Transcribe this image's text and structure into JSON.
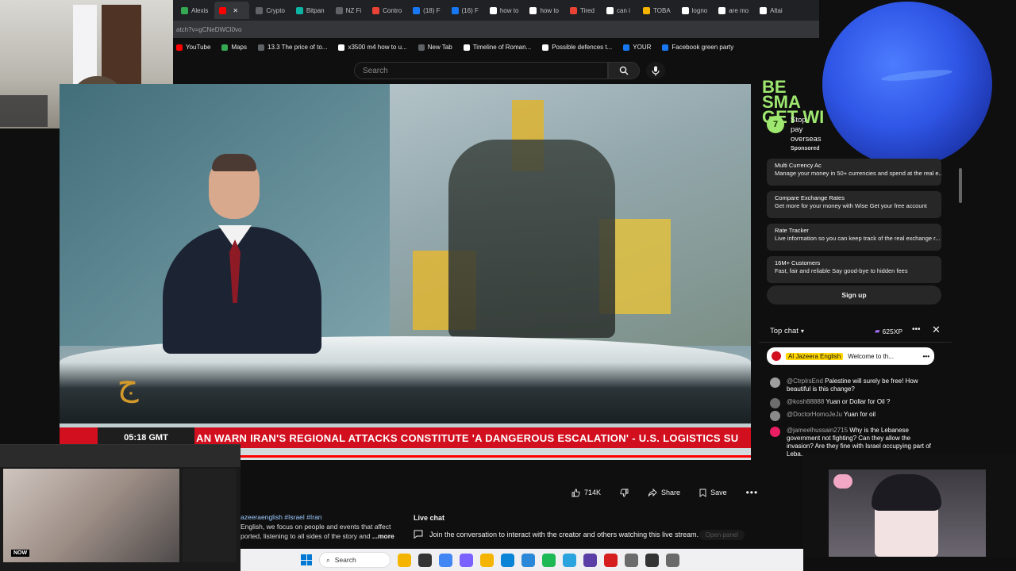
{
  "browser": {
    "tabs": [
      {
        "label": "Alexis",
        "color": "#34a853"
      },
      {
        "label": "",
        "color": "#ff0000",
        "active": true
      },
      {
        "label": "Crypto",
        "color": "#5f6368"
      },
      {
        "label": "Bitpan",
        "color": "#0db5a4"
      },
      {
        "label": "NZ Fi",
        "color": "#5f6368"
      },
      {
        "label": "Contro",
        "color": "#ea4335"
      },
      {
        "label": "(18) F",
        "color": "#1877f2"
      },
      {
        "label": "(16) F",
        "color": "#1877f2"
      },
      {
        "label": "how to",
        "color": "#ffffff"
      },
      {
        "label": "how to",
        "color": "#ffffff"
      },
      {
        "label": "Tired",
        "color": "#ea4335"
      },
      {
        "label": "can i",
        "color": "#ffffff"
      },
      {
        "label": "TOBA",
        "color": "#f4b400"
      },
      {
        "label": "logno",
        "color": "#ffffff"
      },
      {
        "label": "are mo",
        "color": "#ffffff"
      },
      {
        "label": "Altai",
        "color": "#ffffff"
      }
    ],
    "address": "atch?v=gCNeDWCl0vo",
    "bookmarks": [
      {
        "label": "YouTube",
        "color": "#ff0000"
      },
      {
        "label": "Maps",
        "color": "#34a853"
      },
      {
        "label": "13.3 The price of to...",
        "color": "#5f6368"
      },
      {
        "label": "x3500 m4 how to u...",
        "color": "#ffffff"
      },
      {
        "label": "New Tab",
        "color": "#5f6368"
      },
      {
        "label": "Timeline of Roman...",
        "color": "#ffffff"
      },
      {
        "label": "Possible defences t...",
        "color": "#ffffff"
      },
      {
        "label": "YOUR",
        "color": "#1877f2"
      },
      {
        "label": "Facebook green party",
        "color": "#1877f2"
      }
    ]
  },
  "youtube": {
    "search_placeholder": "Search",
    "ticker": {
      "time": "05:18 GMT",
      "text": "AN WARN IRAN'S REGIONAL ATTACKS CONSTITUTE 'A DANGEROUS ESCALATION'  -  U.S. LOGISTICS SU"
    },
    "actions": {
      "likes": "714K",
      "share": "Share",
      "save": "Save"
    },
    "description": {
      "tags": "azeeraenglish #Israel #Iran",
      "line1": "English,  we focus on people and events that affect",
      "line2": "ported, listening to all sides of the story and",
      "more": "...more"
    },
    "live_chat_box": {
      "title": "Live chat",
      "join": "Join the conversation to interact with the creator and others watching this live stream.",
      "open_panel": "Open panel"
    }
  },
  "ad": {
    "banner": "BE SMA GET WI",
    "headline": "Stop pay overseas",
    "sponsored": "Sponsored",
    "logo": "7",
    "cards": [
      {
        "title": "Multi Currency Ac",
        "text": "Manage your money in 50+ currencies and spend at the real e..."
      },
      {
        "title": "Compare Exchange Rates",
        "text": "Get more for your money with Wise Get your free account"
      },
      {
        "title": "Rate Tracker",
        "text": "Live information so you can keep track of the real exchange r..."
      },
      {
        "title": "16M+ Customers",
        "text": "Fast, fair and reliable Say good-bye to hidden fees"
      }
    ],
    "signup": "Sign up"
  },
  "chat": {
    "header": "Top chat",
    "xp": "625XP",
    "pinned": {
      "channel": "Al Jazeera English",
      "text": "Welcome to th..."
    },
    "messages": [
      {
        "author": "@CtrplrsEnd",
        "text": "Palestine will surely be free! How beautiful is this change?",
        "color": "#9e9e9e"
      },
      {
        "author": "@kosh88888",
        "text": "Yuan or Dollar for Oil ?",
        "color": "#6d6d6d"
      },
      {
        "author": "@DoctorHomoJeJu",
        "text": "Yuan for oil",
        "color": "#8a8a8a"
      },
      {
        "author": "@jameelhussain2715",
        "text": "Why is the Lebanese government not fighting? Can they allow the invasion? Are they fine with Israel occupying part of Leba...",
        "color": "#e91e63"
      }
    ]
  },
  "overlays": {
    "news_badge": "NOW"
  },
  "taskbar": {
    "search": "Search",
    "icons": [
      {
        "name": "file-explorer",
        "color": "#f4b400"
      },
      {
        "name": "task-view",
        "color": "#333333"
      },
      {
        "name": "chrome",
        "color": "#4285f4"
      },
      {
        "name": "app-copilot",
        "color": "#7b61ff"
      },
      {
        "name": "folder",
        "color": "#f4b400"
      },
      {
        "name": "edge",
        "color": "#0a84d6"
      },
      {
        "name": "app-store",
        "color": "#2b88d8"
      },
      {
        "name": "app-green",
        "color": "#1db954"
      },
      {
        "name": "telegram",
        "color": "#2aa3df"
      },
      {
        "name": "app-purple",
        "color": "#5b3fa6"
      },
      {
        "name": "acrobat",
        "color": "#d71e1e"
      },
      {
        "name": "settings",
        "color": "#6b6b6b"
      },
      {
        "name": "app-obs",
        "color": "#333333"
      },
      {
        "name": "app-misc",
        "color": "#6a6a6a"
      }
    ]
  }
}
